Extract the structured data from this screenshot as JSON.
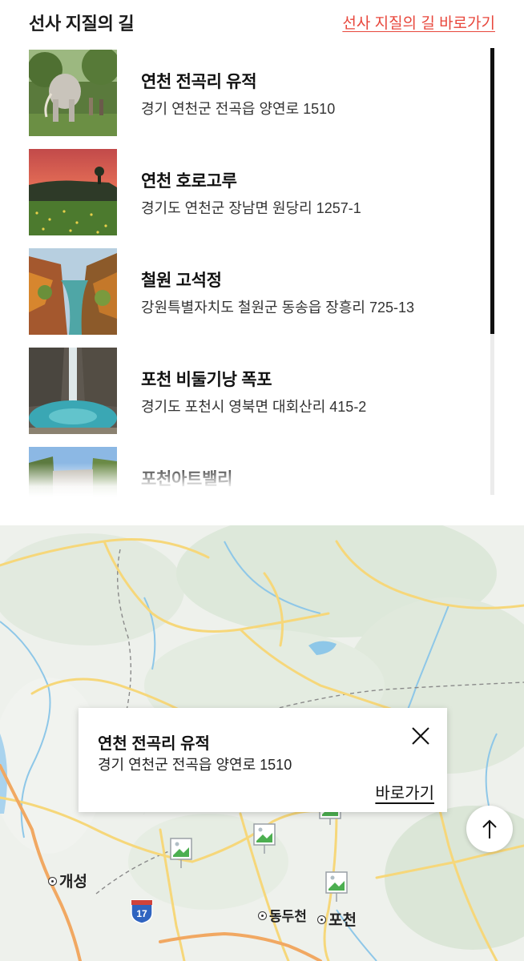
{
  "header": {
    "title": "선사 지질의 길",
    "link_label": "선사 지질의 길 바로가기"
  },
  "places": [
    {
      "name": "연천 전곡리 유적",
      "address": "경기 연천군 전곡읍 양연로 1510",
      "thumb": "mammoth-statue-photo"
    },
    {
      "name": "연천 호로고루",
      "address": "경기도 연천군 장남면 원당리 1257-1",
      "thumb": "fortress-sunset-photo"
    },
    {
      "name": "철원 고석정",
      "address": "강원특별자치도 철원군 동송읍 장흥리 725-13",
      "thumb": "river-gorge-photo"
    },
    {
      "name": "포천 비둘기낭 폭포",
      "address": "경기도 포천시 영북면 대회산리 415-2",
      "thumb": "waterfall-photo"
    },
    {
      "name": "포천아트밸리",
      "address": "",
      "thumb": "cliff-lake-photo"
    }
  ],
  "popup": {
    "title": "연천 전곡리 유적",
    "address": "경기 연천군 전곡읍 양연로 1510",
    "go_label": "바로가기"
  },
  "map": {
    "cities": {
      "gaeseong": "개성",
      "dongducheon": "동두천",
      "pocheon": "포천"
    },
    "route_number": "17"
  },
  "colors": {
    "accent": "#e8473c",
    "map_land": "#eef1ec",
    "map_road": "#f6d77a",
    "map_river": "#8ec7e8"
  },
  "list_scroll_fraction_visible": 0.64
}
